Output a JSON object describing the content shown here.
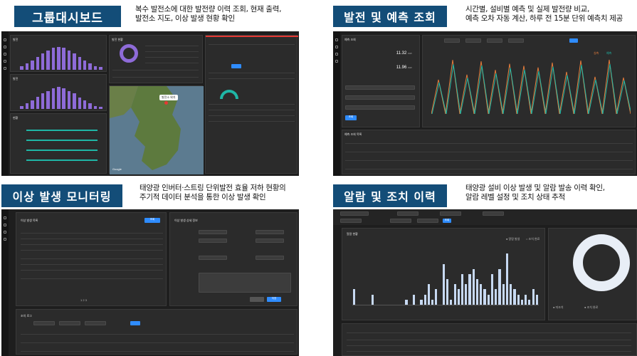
{
  "sections": [
    {
      "title": "그룹대시보드",
      "desc_line1": "복수 발전소에 대한 발전량 이력 조회, 현재 출력,",
      "desc_line2": "발전소 지도, 이상 발생 현황 확인"
    },
    {
      "title": "발전 및 예측 조회",
      "desc_line1": "시간별, 설비별 예측 및 실제 발전량 비교,",
      "desc_line2": "예측 오차 자동 계산, 하루 전 15분 단위 예측치 제공"
    },
    {
      "title": "이상 발생 모니터링",
      "desc_line1": "태양광 인버터·스트링 단위발전 효율 저하 현황의",
      "desc_line2": "주기적 데이터 분석을 통한 이상 발생 확인"
    },
    {
      "title": "알람 및 조치 이력",
      "desc_line1": "태양광 설비 이상 발생 및 알람 발송 이력 확인,",
      "desc_line2": "알람 레벨 설정 및 조치 상태 추적"
    }
  ],
  "dashboard": {
    "panel1": "발전",
    "panel2": "발전",
    "panel3": "현황",
    "gauge_title": "발전 현황",
    "map_label": "발전소 위치",
    "map_credit": "Google",
    "gen_bars": [
      6,
      10,
      14,
      20,
      26,
      30,
      34,
      36,
      34,
      30,
      26,
      20,
      14,
      10,
      6,
      4
    ],
    "gen_bars2": [
      5,
      9,
      13,
      19,
      24,
      28,
      32,
      34,
      32,
      28,
      24,
      18,
      13,
      9,
      5,
      3
    ]
  },
  "forecast": {
    "title": "예측 조회",
    "value1": "11.32",
    "value2": "11.96",
    "unit": "kWh",
    "search_label": "조회",
    "table_title": "예측 조회 목록",
    "legend": [
      "실측",
      "예측"
    ]
  },
  "anomaly": {
    "list_title": "이상 발생 목록",
    "detail_title": "이상 발생 상세 정보",
    "log_title": "조치 로그",
    "search_label": "조회",
    "save_label": "저장",
    "pages": [
      "1",
      "2",
      "3"
    ]
  },
  "alarm": {
    "chart_title": "알람 현황",
    "filter_label": "조회",
    "legend": [
      "알람 발생",
      "조치 완료"
    ],
    "bars": [
      3,
      0,
      0,
      0,
      0,
      2,
      0,
      0,
      0,
      0,
      0,
      0,
      0,
      0,
      1,
      0,
      2,
      0,
      1,
      2,
      4,
      1,
      3,
      0,
      8,
      5,
      1,
      4,
      3,
      6,
      4,
      6,
      7,
      5,
      4,
      3,
      2,
      6,
      3,
      7,
      4,
      10,
      4,
      3,
      2,
      1,
      2,
      1,
      3,
      2
    ],
    "donut_legend": [
      "미조치",
      "조치 완료"
    ]
  }
}
